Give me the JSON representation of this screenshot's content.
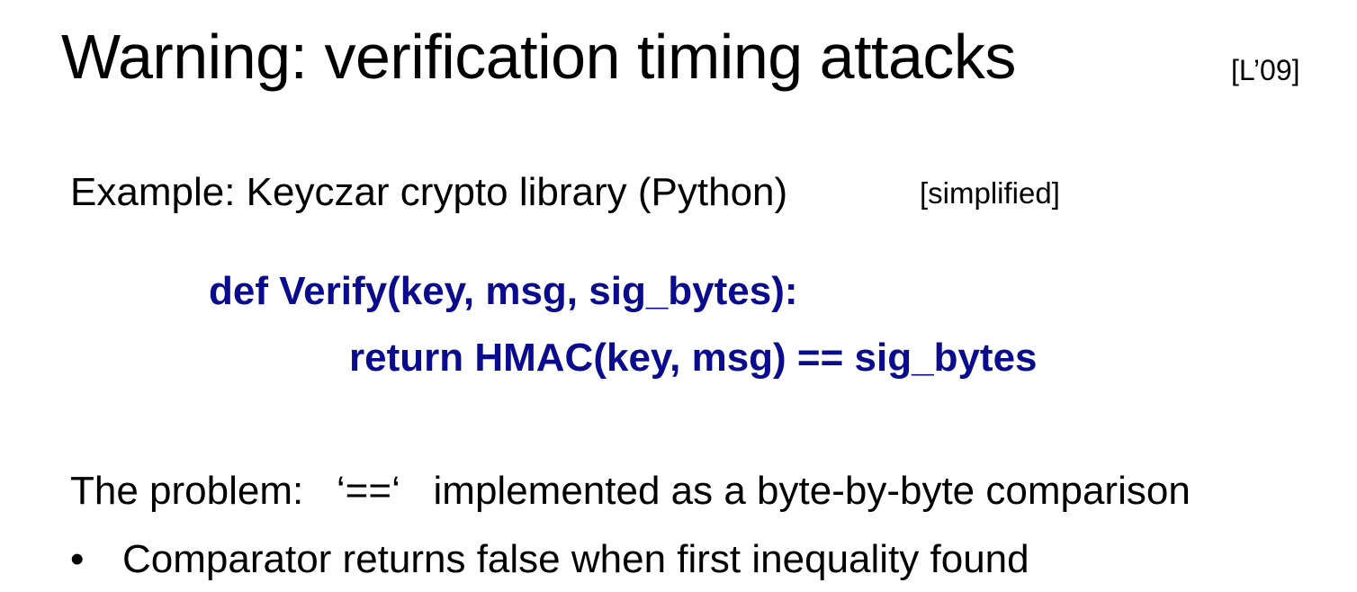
{
  "slide": {
    "title": "Warning:  verification timing attacks",
    "citation": "[L’09]",
    "example_text": "Example: Keyczar crypto library  (Python)",
    "example_note": "[simplified]",
    "code_color": "#0B0B8F",
    "code_lines": [
      "def Verify(key, msg, sig_bytes):",
      "return HMAC(key, msg) == sig_bytes"
    ],
    "problem_text": "The problem:   ‘==‘   implemented as a byte-by-byte comparison",
    "bullets": [
      {
        "marker": "•",
        "text": "Comparator returns false when first inequality found"
      }
    ]
  }
}
